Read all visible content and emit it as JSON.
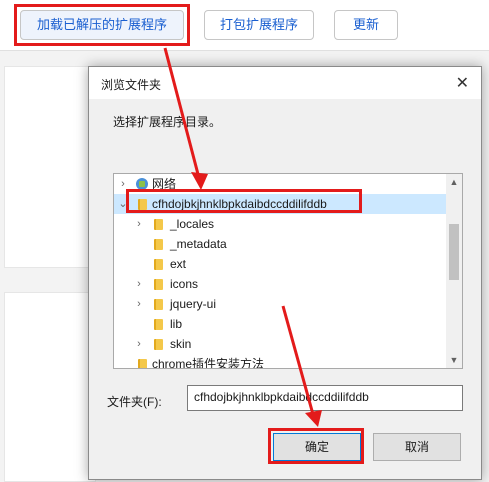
{
  "toolbar": {
    "load_unpacked": "加载已解压的扩展程序",
    "pack_extension": "打包扩展程序",
    "update": "更新"
  },
  "dialog": {
    "title": "浏览文件夹",
    "instruction": "选择扩展程序目录。",
    "tree": [
      {
        "label": "网络",
        "icon": "network-icon",
        "expandable": true
      },
      {
        "label": "cfhdojbkjhnklbpkdaibdccddilifddb",
        "icon": "folder-icon",
        "expanded": true,
        "selected": true
      },
      {
        "label": "_locales",
        "icon": "folder-icon",
        "expandable": true
      },
      {
        "label": "_metadata",
        "icon": "folder-icon",
        "expandable": false
      },
      {
        "label": "ext",
        "icon": "folder-icon",
        "expandable": false
      },
      {
        "label": "icons",
        "icon": "folder-icon",
        "expandable": true
      },
      {
        "label": "jquery-ui",
        "icon": "folder-icon",
        "expandable": true
      },
      {
        "label": "lib",
        "icon": "folder-icon",
        "expandable": false
      },
      {
        "label": "skin",
        "icon": "folder-icon",
        "expandable": true
      },
      {
        "label": "chrome插件安装方法",
        "icon": "folder-icon",
        "expandable": false
      }
    ],
    "folder_label": "文件夹(F):",
    "folder_value": "cfhdojbkjhnklbpkdaibdccddilifddb",
    "ok": "确定",
    "cancel": "取消"
  },
  "colors": {
    "highlight": "#e31b1b",
    "link_blue": "#1a5fd0",
    "selection": "#cce8ff"
  }
}
